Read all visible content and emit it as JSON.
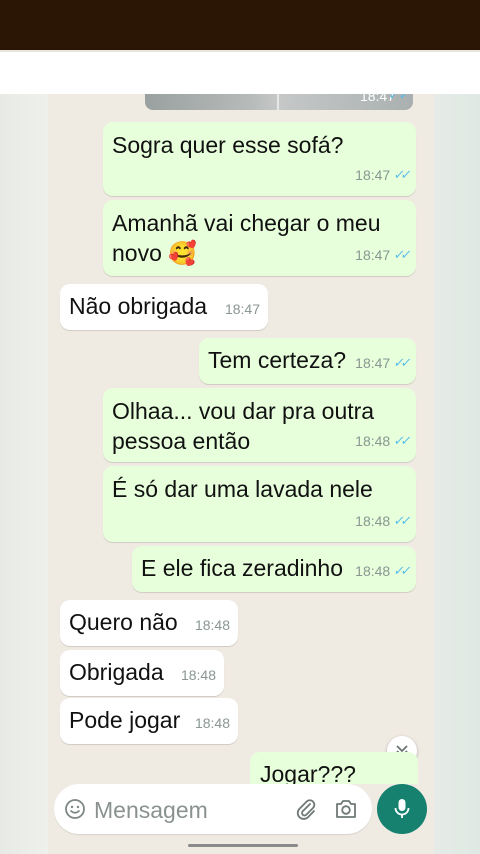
{
  "chat": {
    "image_message": {
      "time": "18:47"
    },
    "messages": [
      {
        "id": "m1",
        "dir": "out",
        "text": "Sogra quer esse sofá?",
        "time": "18:47",
        "ticks": "✓✓"
      },
      {
        "id": "m2",
        "dir": "out",
        "text": "Amanhã vai chegar o meu\nnovo 🥰",
        "time": "18:47",
        "ticks": "✓✓"
      },
      {
        "id": "m3",
        "dir": "in",
        "text": "Não obrigada",
        "time": "18:47"
      },
      {
        "id": "m4",
        "dir": "out",
        "text": "Tem certeza?",
        "time": "18:47",
        "ticks": "✓✓"
      },
      {
        "id": "m5",
        "dir": "out",
        "text": "Olhaa... vou dar pra outra\npessoa então",
        "time": "18:48",
        "ticks": "✓✓"
      },
      {
        "id": "m6",
        "dir": "out",
        "text": "É só dar uma lavada nele",
        "time": "18:48",
        "ticks": "✓✓"
      },
      {
        "id": "m7",
        "dir": "out",
        "text": "E ele fica zeradinho",
        "time": "18:48",
        "ticks": "✓✓"
      },
      {
        "id": "m8",
        "dir": "in",
        "text": "Quero não",
        "time": "18:48"
      },
      {
        "id": "m9",
        "dir": "in",
        "text": "Obrigada",
        "time": "18:48"
      },
      {
        "id": "m10",
        "dir": "in",
        "text": "Pode jogar",
        "time": "18:48"
      },
      {
        "id": "m11",
        "dir": "out",
        "text": "Jogar???"
      }
    ]
  },
  "composer": {
    "placeholder": "Mensagem",
    "icons": [
      "emoji-icon",
      "paperclip-icon",
      "camera-icon",
      "microphone-icon"
    ]
  },
  "colors": {
    "outgoing_bubble": "#e7ffdb",
    "incoming_bubble": "#ffffff",
    "chat_background": "#efeae2",
    "read_ticks": "#53bdeb",
    "mic_button": "#15816e",
    "top_bar": "#2b1505"
  }
}
